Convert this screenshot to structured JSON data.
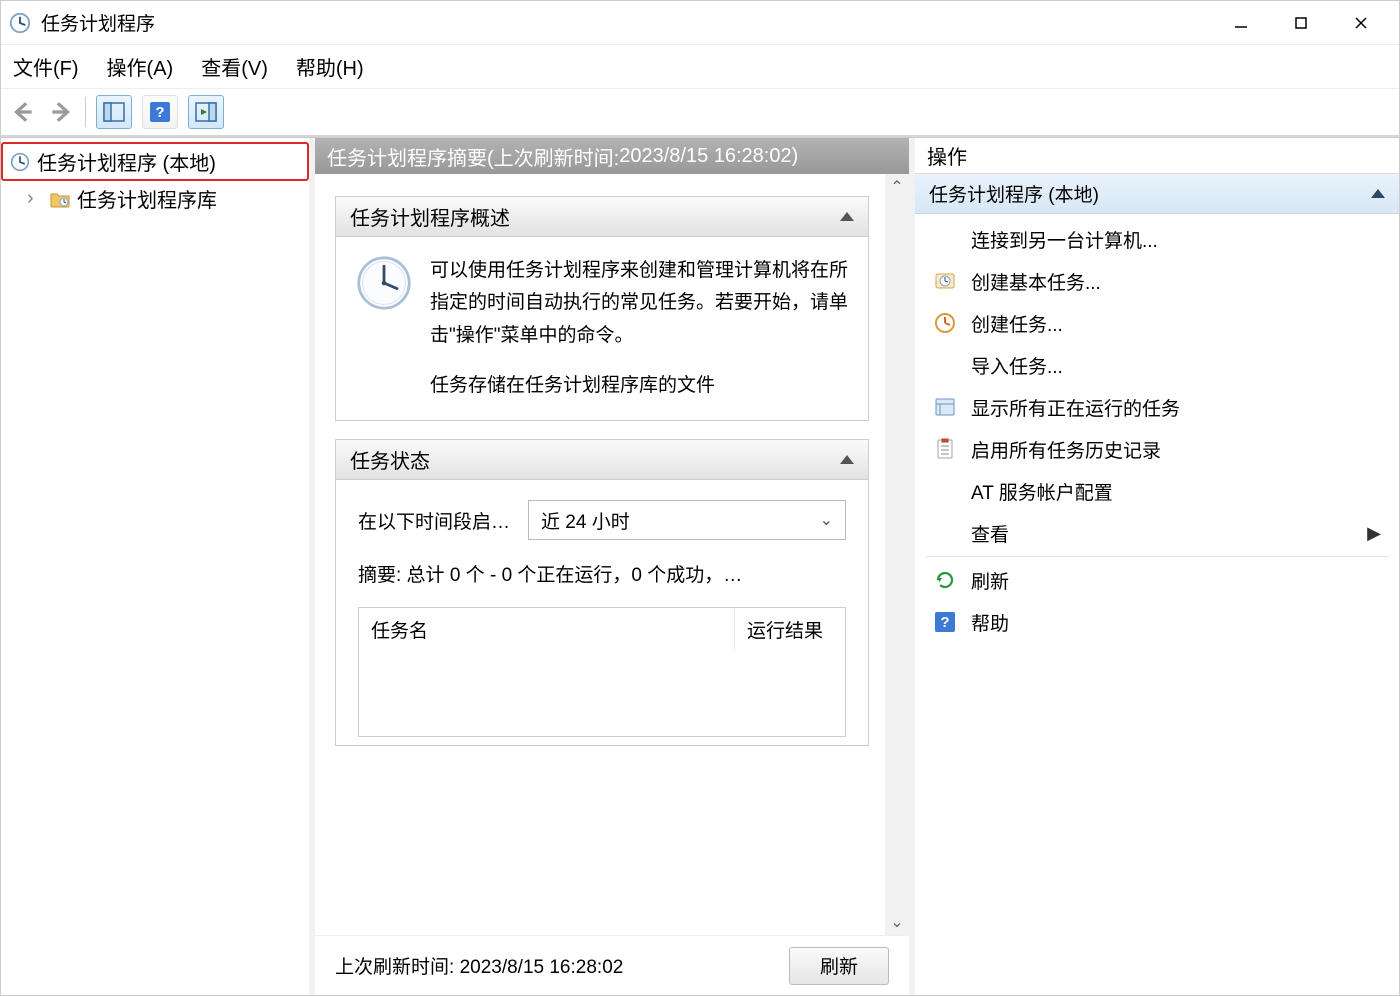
{
  "titlebar": {
    "title": "任务计划程序"
  },
  "menubar": {
    "file": "文件(F)",
    "action": "操作(A)",
    "view": "查看(V)",
    "help": "帮助(H)"
  },
  "tree": {
    "root": "任务计划程序 (本地)",
    "child": "任务计划程序库"
  },
  "center": {
    "header_prefix": "任务计划程序摘要(上次刷新时间: ",
    "header_time": "2023/8/15 16:28:02",
    "header_suffix": ")",
    "overview_title": "任务计划程序概述",
    "overview_text": "可以使用任务计划程序来创建和管理计算机将在所指定的时间自动执行的常见任务。若要开始，请单击\"操作\"菜单中的命令。",
    "overview_extra": "任务存储在任务计划程序库的文件",
    "status_title": "任务状态",
    "status_label": "在以下时间段启…",
    "status_range": "近 24 小时",
    "status_summary": "摘要: 总计 0 个 - 0 个正在运行，0 个成功，…",
    "task_col_name": "任务名",
    "task_col_result": "运行结果",
    "footer_label": "上次刷新时间: ",
    "footer_time": "2023/8/15 16:28:02",
    "refresh_btn": "刷新"
  },
  "actions": {
    "title": "操作",
    "group": "任务计划程序 (本地)",
    "items": [
      "连接到另一台计算机...",
      "创建基本任务...",
      "创建任务...",
      "导入任务...",
      "显示所有正在运行的任务",
      "启用所有任务历史记录",
      "AT 服务帐户配置",
      "查看",
      "刷新",
      "帮助"
    ]
  }
}
